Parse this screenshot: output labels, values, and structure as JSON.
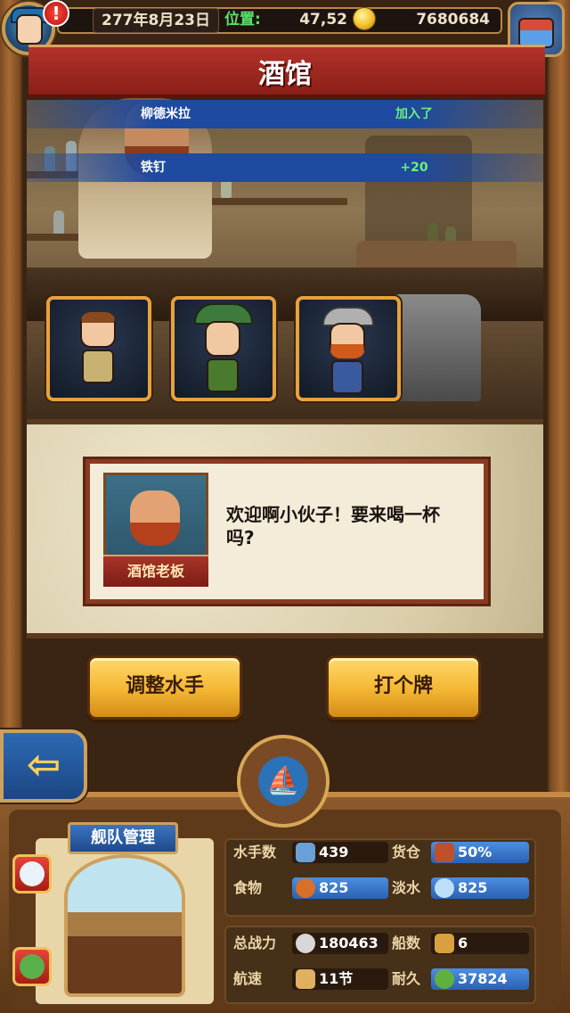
{
  "topbar": {
    "date": "277年8月23日",
    "position_label": "位置:",
    "position_value": "47,52",
    "gold": "7680684",
    "alert_badge": "!"
  },
  "title": "酒馆",
  "notifications": [
    {
      "name": "柳德米拉",
      "value": "加入了"
    },
    {
      "name": "铁钉",
      "value": "+20"
    }
  ],
  "crew_cards": [
    {
      "icon": "crew-scholar-icon",
      "hair": "#8a4a1c",
      "body": "#c8b272"
    },
    {
      "icon": "crew-hunter-icon",
      "hair": "#3e7a3c",
      "body": "#4a7a2e"
    },
    {
      "icon": "crew-viking-icon",
      "hair": "#b0b0b0",
      "body": "#3a5aa0"
    }
  ],
  "dialog": {
    "speaker_tag": "酒馆老板",
    "text": "欢迎啊小伙子！要来喝一杯吗?"
  },
  "buttons": {
    "adjust_crew": "调整水手",
    "play_cards": "打个牌"
  },
  "fleet": {
    "tag": "舰队管理",
    "stats": {
      "sailors_label": "水手数",
      "sailors": "439",
      "cargo_label": "货仓",
      "cargo": "50%",
      "food_label": "食物",
      "food": "825",
      "water_label": "淡水",
      "water": "825",
      "power_label": "总战力",
      "power": "180463",
      "ships_label": "船数",
      "ships": "6",
      "speed_label": "航速",
      "speed": "11节",
      "durability_label": "耐久",
      "durability": "37824"
    }
  },
  "colors": {
    "title_red": "#a8291f",
    "frame_wood": "#7a4a22",
    "notif_blue": "#1e4aa0",
    "notif_green": "#6cf07a",
    "button_gold": "#f3b632",
    "stat_blue": "#2a62b4"
  }
}
